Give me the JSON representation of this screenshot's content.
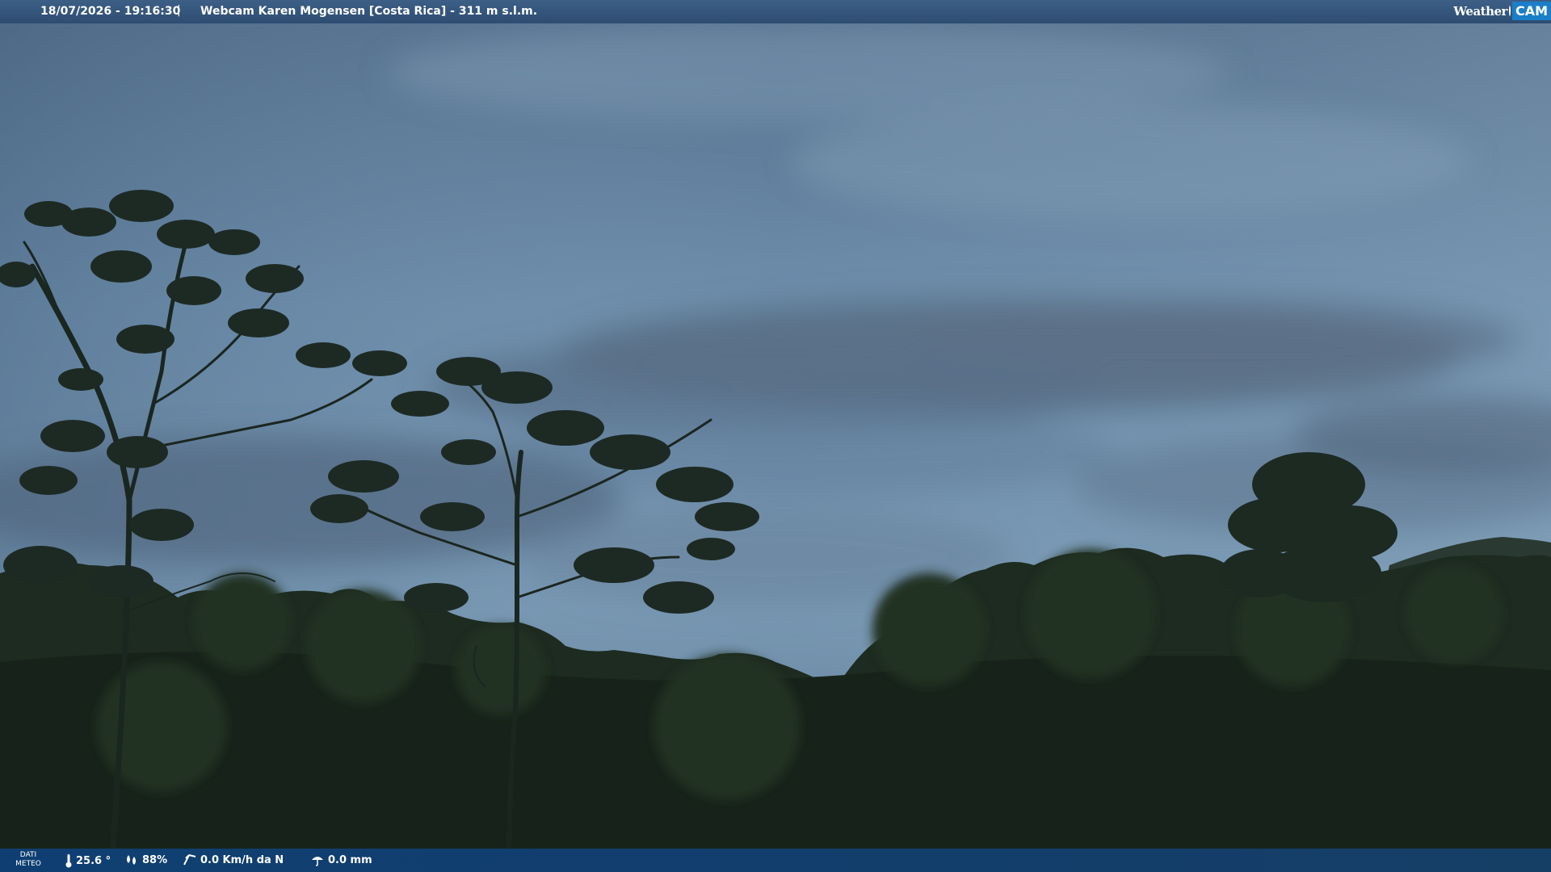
{
  "header": {
    "timestamp": "18/07/2026 - 19:16:30",
    "separator": "|",
    "title": "Webcam Karen Mogensen [Costa Rica]  - 311 m s.l.m.",
    "logo": {
      "word": "Weather",
      "cam": "CAM"
    }
  },
  "weather": {
    "label_line1": "DATI",
    "label_line2": "METEO",
    "temperature": "25.6 °",
    "humidity": "88%",
    "wind": "0.0 Km/h da N",
    "rain": "0.0 mm"
  },
  "colors": {
    "top_bar": "#2d4c72",
    "bottom_bar": "#123e6c",
    "sky": "#6d8eac",
    "vegetation": "#1c2a1e",
    "logo_accent": "#1b7ec9"
  }
}
